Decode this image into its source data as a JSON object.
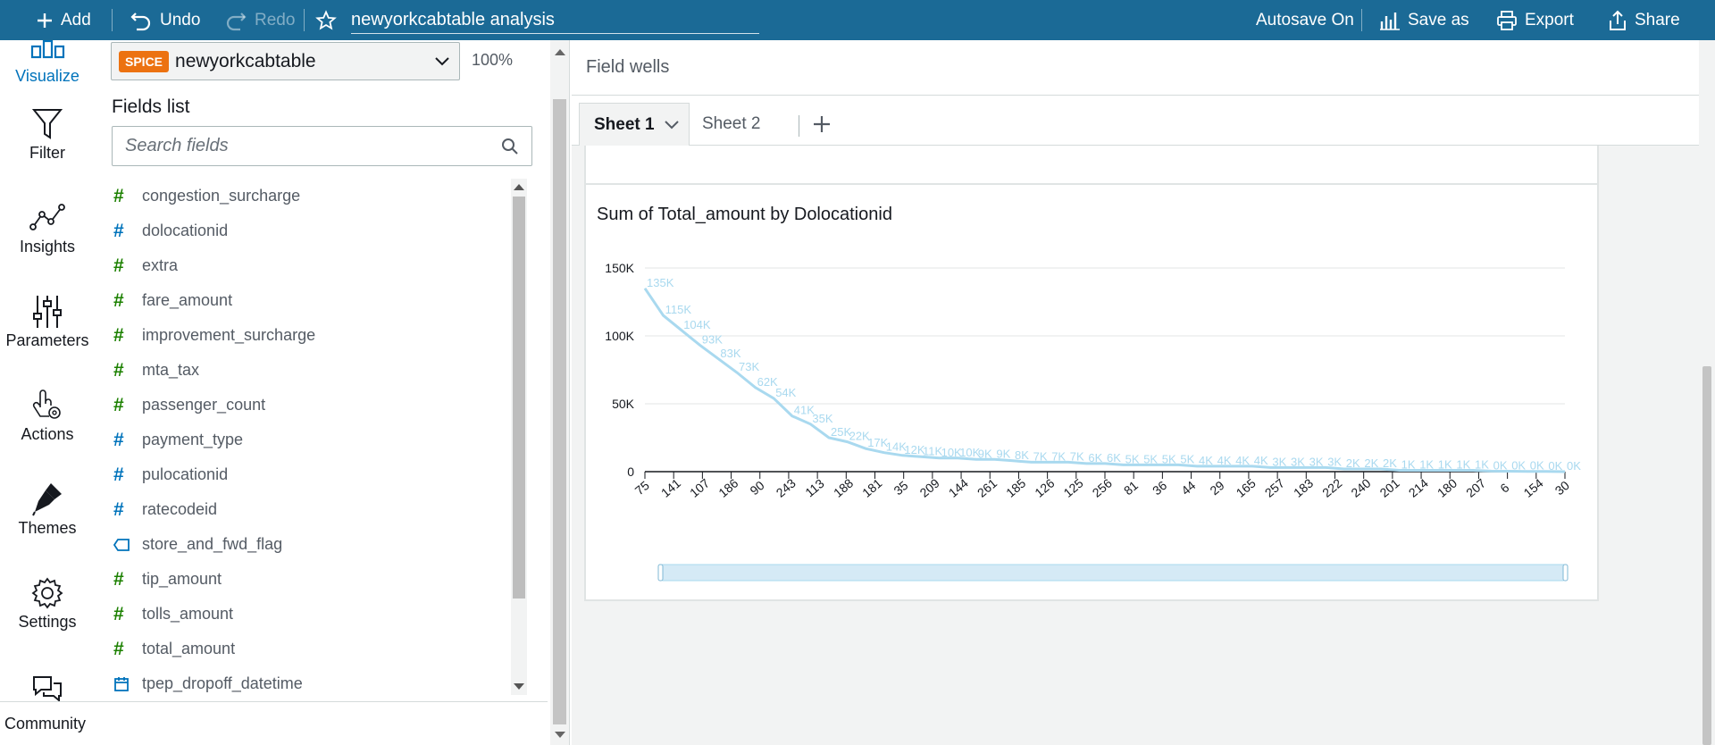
{
  "toolbar": {
    "add_label": "Add",
    "undo_label": "Undo",
    "redo_label": "Redo",
    "analysis_title": "newyorkcabtable analysis",
    "autosave_label": "Autosave On",
    "save_as_label": "Save as",
    "export_label": "Export",
    "share_label": "Share"
  },
  "rail": {
    "items": [
      {
        "label": "Visualize",
        "icon": "visualize-icon",
        "active": true
      },
      {
        "label": "Filter",
        "icon": "filter-icon"
      },
      {
        "label": "Insights",
        "icon": "insights-icon"
      },
      {
        "label": "Parameters",
        "icon": "parameters-icon"
      },
      {
        "label": "Actions",
        "icon": "actions-icon"
      },
      {
        "label": "Themes",
        "icon": "themes-icon"
      },
      {
        "label": "Settings",
        "icon": "gear-icon"
      },
      {
        "label": "Community",
        "icon": "community-icon"
      }
    ]
  },
  "dataset": {
    "badge": "SPICE",
    "name": "newyorkcabtable",
    "spice_percent": "100%"
  },
  "fields": {
    "title": "Fields list",
    "search_placeholder": "Search fields",
    "items": [
      {
        "name": "congestion_surcharge",
        "type": "measure"
      },
      {
        "name": "dolocationid",
        "type": "dimension"
      },
      {
        "name": "extra",
        "type": "measure"
      },
      {
        "name": "fare_amount",
        "type": "measure"
      },
      {
        "name": "improvement_surcharge",
        "type": "measure"
      },
      {
        "name": "mta_tax",
        "type": "measure"
      },
      {
        "name": "passenger_count",
        "type": "measure"
      },
      {
        "name": "payment_type",
        "type": "dimension"
      },
      {
        "name": "pulocationid",
        "type": "dimension"
      },
      {
        "name": "ratecodeid",
        "type": "dimension"
      },
      {
        "name": "store_and_fwd_flag",
        "type": "string"
      },
      {
        "name": "tip_amount",
        "type": "measure"
      },
      {
        "name": "tolls_amount",
        "type": "measure"
      },
      {
        "name": "total_amount",
        "type": "measure"
      },
      {
        "name": "tpep_dropoff_datetime",
        "type": "date"
      }
    ]
  },
  "main": {
    "field_wells_label": "Field wells",
    "sheets": [
      "Sheet 1",
      "Sheet 2"
    ]
  },
  "colors": {
    "topbar": "#1b6a96",
    "line": "#a9d9ef",
    "measure": "#1d8102",
    "dimension": "#0073bb"
  },
  "chart_data": {
    "type": "line",
    "title": "Sum of Total_amount by Dolocationid",
    "ylim": [
      0,
      150000
    ],
    "y_ticks": [
      "0",
      "50K",
      "100K",
      "150K"
    ],
    "x_tick_labels": [
      "75",
      "141",
      "107",
      "186",
      "90",
      "243",
      "113",
      "188",
      "181",
      "35",
      "209",
      "144",
      "261",
      "185",
      "126",
      "125",
      "256",
      "81",
      "36",
      "44",
      "29",
      "165",
      "257",
      "183",
      "222",
      "240",
      "201",
      "214",
      "180",
      "207",
      "6",
      "154",
      "30"
    ],
    "data_labels": [
      "135K",
      "115K",
      "104K",
      "93K",
      "83K",
      "73K",
      "62K",
      "54K",
      "41K",
      "35K",
      "25K",
      "22K",
      "17K",
      "14K",
      "12K",
      "11K",
      "10K",
      "10K",
      "9K",
      "9K",
      "8K",
      "7K",
      "7K",
      "7K",
      "6K",
      "6K",
      "5K",
      "5K",
      "5K",
      "5K",
      "4K",
      "4K",
      "4K",
      "4K",
      "3K",
      "3K",
      "3K",
      "3K",
      "2K",
      "2K",
      "2K",
      "1K",
      "1K",
      "1K",
      "1K",
      "1K",
      "0K",
      "0K",
      "0K",
      "0K",
      "0K"
    ],
    "values": [
      135000,
      115000,
      104000,
      93000,
      83000,
      73000,
      62000,
      54000,
      41000,
      35000,
      25000,
      22000,
      17000,
      14000,
      12000,
      11000,
      10000,
      10000,
      9000,
      9000,
      8000,
      7000,
      7000,
      7000,
      6000,
      6000,
      5000,
      5000,
      5000,
      5000,
      4000,
      4000,
      4000,
      4000,
      3000,
      3000,
      3000,
      3000,
      2000,
      2000,
      2000,
      1000,
      1000,
      1000,
      1000,
      1000,
      400,
      300,
      200,
      100,
      0
    ]
  }
}
